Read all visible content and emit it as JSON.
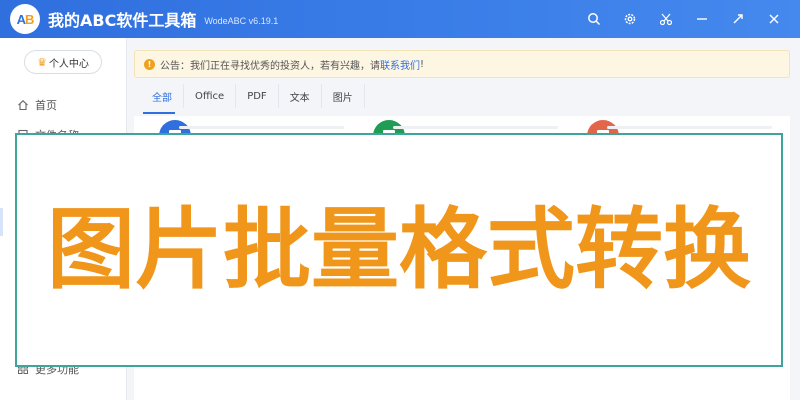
{
  "titlebar": {
    "logo_text_a": "A",
    "logo_text_b": "B",
    "title": "我的ABC软件工具箱",
    "version": "WodeABC v6.19.1",
    "icons": [
      "search-icon",
      "gear-icon",
      "scissors-icon",
      "minimize-icon",
      "maximize-icon",
      "close-icon"
    ]
  },
  "sidebar": {
    "vip_label": "个人中心",
    "items": [
      {
        "label": "首页",
        "icon": "home-icon"
      },
      {
        "label": "文件名称",
        "icon": "file-icon"
      },
      {
        "label": "更多功能",
        "icon": "grid-icon"
      }
    ]
  },
  "main": {
    "notice_prefix": "公告：我们正在寻找优秀的投资人，若有兴趣，请",
    "notice_link": "联系我们",
    "notice_suffix": "!",
    "tabs": [
      "全部",
      "Office",
      "PDF",
      "文本",
      "图片"
    ],
    "cards": [
      {
        "icon": "word-icon",
        "glyph": "W",
        "color": "#2f6fde"
      },
      {
        "icon": "excel-icon",
        "glyph": "X",
        "color": "#1f9d55"
      },
      {
        "icon": "ppt-icon",
        "glyph": "P",
        "color": "#e2664a"
      }
    ]
  },
  "banner": {
    "text": "图片批量格式转换",
    "color": "#f0961a",
    "border_color": "#3ea59a"
  }
}
